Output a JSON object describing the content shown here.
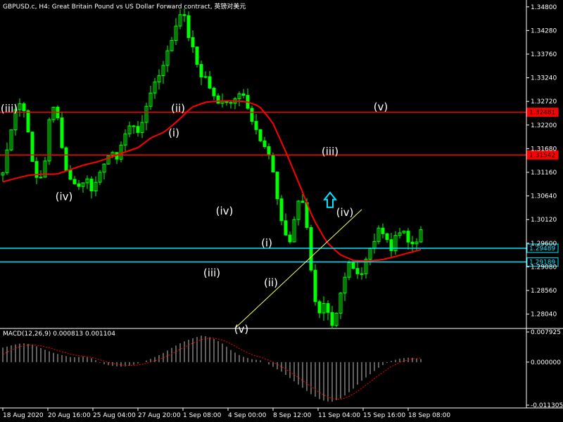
{
  "window": {
    "title": "GBPUSD.c, H4:  Great Britain Pound vs US Dollar Forward contract, 英镑对美元"
  },
  "macd": {
    "title": "MACD(12,26,9) 0.000813 0.001104",
    "y_ticks": [
      "0.007925",
      "0.000000",
      "-0.011305"
    ],
    "range": [
      -0.011305,
      0.007925
    ]
  },
  "colors": {
    "background": "#000000",
    "bull": "#00ff00",
    "ma": "#ff0000",
    "resistance": "#ff0000",
    "support": "#00e5ff",
    "trendline": "#ffff66",
    "arrow": "#00e5ff",
    "axis": "#ffffff",
    "signal": "#ff0000"
  },
  "chart_data": {
    "type": "candlestick",
    "symbol": "GBPUSD.c",
    "timeframe": "H4",
    "ylim": [
      1.2774,
      1.3492
    ],
    "y_ticks": [
      "1.34800",
      "1.34280",
      "1.33760",
      "1.33240",
      "1.32720",
      "1.32200",
      "1.31680",
      "1.31160",
      "1.30640",
      "1.30120",
      "1.29600",
      "1.29080",
      "1.28560",
      "1.28040"
    ],
    "x_ticks": [
      "18 Aug 2020",
      "20 Aug 16:00",
      "25 Aug 04:00",
      "27 Aug 20:00",
      "1 Sep 08:00",
      "4 Sep 00:00",
      "8 Sep 12:00",
      "11 Sep 04:00",
      "15 Sep 16:00",
      "18 Sep 08:00"
    ],
    "price_path": [
      1.3115,
      1.3185,
      1.3255,
      1.327,
      1.3235,
      1.313,
      1.309,
      1.3135,
      1.3255,
      1.326,
      1.316,
      1.31,
      1.3095,
      1.308,
      1.311,
      1.3075,
      1.31,
      1.314,
      1.316,
      1.3145,
      1.3185,
      1.3215,
      1.322,
      1.32,
      1.326,
      1.3305,
      1.3325,
      1.336,
      1.3395,
      1.344,
      1.348,
      1.342,
      1.338,
      1.333,
      1.3325,
      1.329,
      1.3265,
      1.328,
      1.3265,
      1.3285,
      1.33,
      1.3255,
      1.3215,
      1.319,
      1.317,
      1.314,
      1.305,
      1.299,
      1.296,
      1.303,
      1.307,
      1.299,
      1.284,
      1.28,
      1.283,
      1.277,
      1.281,
      1.288,
      1.292,
      1.29,
      1.289,
      1.293,
      1.296,
      1.299,
      1.2985,
      1.294,
      1.299,
      1.2985,
      1.296,
      1.295,
      1.299
    ],
    "ma_path": [
      1.3095,
      1.3103,
      1.311,
      1.3112,
      1.3112,
      1.3122,
      1.3132,
      1.3139,
      1.3149,
      1.316,
      1.317,
      1.3192,
      1.3205,
      1.323,
      1.3259,
      1.327,
      1.3273,
      1.3273,
      1.3272,
      1.3262,
      1.3226,
      1.316,
      1.3089,
      1.3015,
      1.2963,
      1.2935,
      1.2922,
      1.2921,
      1.2923,
      1.293,
      1.2938,
      1.2946
    ],
    "horizontal_levels": [
      {
        "label": "1.32481",
        "value": 1.32481,
        "kind": "resistance"
      },
      {
        "label": "1.31542",
        "value": 1.31542,
        "kind": "resistance"
      },
      {
        "label": "1.29489",
        "value": 1.29489,
        "kind": "support"
      },
      {
        "label": "1.29189",
        "value": 1.29189,
        "kind": "support"
      }
    ],
    "trendline": {
      "from": [
        55,
        1.2773
      ],
      "to": [
        75,
        1.2997
      ]
    },
    "wave_labels": [
      {
        "text": "(iii)",
        "x": 1.5,
        "price": 1.3248
      },
      {
        "text": "(iv)",
        "x": 14.5,
        "price": 1.3055
      },
      {
        "text": "(ii)",
        "x": 41.5,
        "price": 1.3249
      },
      {
        "text": "(i)",
        "x": 40.5,
        "price": 1.3195
      },
      {
        "text": "(iv)",
        "x": 52.5,
        "price": 1.3023
      },
      {
        "text": "(iii)",
        "x": 49.5,
        "price": 1.2887
      },
      {
        "text": "(v)",
        "x": 56.5,
        "price": 1.2763
      },
      {
        "text": "(i)",
        "x": 62.5,
        "price": 1.2953
      },
      {
        "text": "(ii)",
        "x": 63.5,
        "price": 1.2865
      },
      {
        "text": "(v)",
        "x": 89.5,
        "price": 1.3252
      },
      {
        "text": "(iii)",
        "x": 77.5,
        "price": 1.3154
      },
      {
        "text": "(iv)",
        "x": 81,
        "price": 1.302
      }
    ],
    "arrow": {
      "x": 77.5,
      "price": 1.3056,
      "direction": "up"
    },
    "macd_hist": [
      0.0038,
      0.0045,
      0.005,
      0.0046,
      0.0035,
      0.0025,
      0.0018,
      0.0012,
      0.0015,
      0.001,
      -0.0005,
      -0.001,
      -0.0012,
      -0.0008,
      0.0,
      0.001,
      0.0022,
      0.0038,
      0.0052,
      0.0062,
      0.007,
      0.0064,
      0.005,
      0.003,
      0.0015,
      0.0008,
      0.0004,
      -0.001,
      -0.0025,
      -0.0045,
      -0.0065,
      -0.0085,
      -0.01,
      -0.0105,
      -0.0095,
      -0.0075,
      -0.005,
      -0.003,
      -0.001,
      0.0003,
      0.001,
      0.0012,
      0.0008
    ],
    "macd_signal": [
      0.002,
      0.0034,
      0.0043,
      0.0046,
      0.0042,
      0.0035,
      0.0027,
      0.0019,
      0.0016,
      0.0012,
      0.0004,
      -0.0003,
      -0.0008,
      -0.0009,
      -0.0006,
      0.0001,
      0.001,
      0.0022,
      0.0036,
      0.0049,
      0.006,
      0.0064,
      0.0059,
      0.0047,
      0.0032,
      0.002,
      0.0012,
      0.0002,
      -0.0012,
      -0.0028,
      -0.0046,
      -0.0065,
      -0.0083,
      -0.0096,
      -0.0098,
      -0.0088,
      -0.007,
      -0.005,
      -0.003,
      -0.0012,
      0.0001,
      0.0008,
      0.0011
    ]
  }
}
